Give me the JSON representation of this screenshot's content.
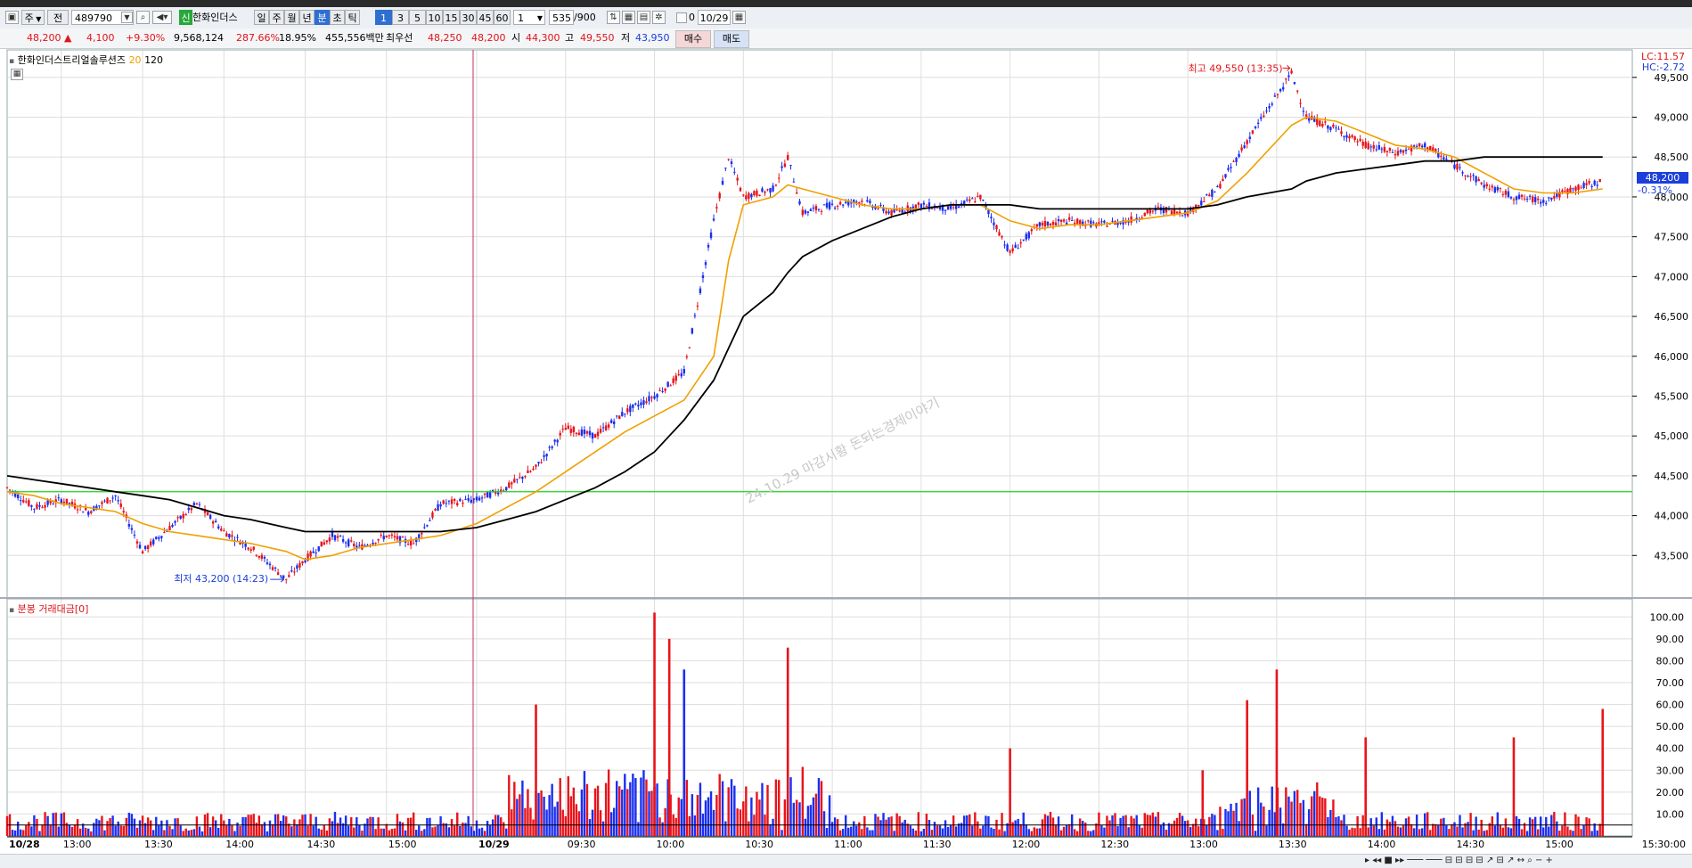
{
  "toolbar": {
    "type_label": "주",
    "prev_label": "전",
    "code": "489790",
    "badge": "신",
    "name": "한화인더스",
    "periods": [
      "일",
      "주",
      "월",
      "년",
      "분",
      "초",
      "틱"
    ],
    "active_period": "분",
    "intervals": [
      "1",
      "3",
      "5",
      "10",
      "15",
      "30",
      "45",
      "60"
    ],
    "active_interval": "1",
    "custom_interval": "1",
    "count": "535",
    "count_total": "/900",
    "date_checkbox_label": "0",
    "date": "10/29"
  },
  "quote": {
    "price": "48,200",
    "change_arrow": "▲",
    "change": "4,100",
    "change_pct": "+9.30%",
    "volume": "9,568,124",
    "vol_ratio": "287.66%",
    "turnover": "18.95%",
    "amount": "455,556백만",
    "bid_label": "최우선",
    "bid": "48,250",
    "ask": "48,200",
    "open_label": "시",
    "open": "44,300",
    "high_label": "고",
    "high": "49,550",
    "low_label": "저",
    "low": "43,950",
    "buy_label": "매수",
    "sell_label": "매도"
  },
  "price_panel": {
    "legend_name": "한화인더스트리얼솔루션즈",
    "ma1_label": "20",
    "ma2_label": "120",
    "max_annotation": "최고 49,550 (13:35)",
    "min_annotation": "최저 43,200 (14:23)",
    "watermark": "24.10.29 마감시황 돈되는경제이야기",
    "lc": "LC:11.57",
    "hc": "HC:-2.72",
    "price_tag": "48,200",
    "price_tag_pct": "-0.31%"
  },
  "volume_panel": {
    "legend": "분봉 거래대금[0]"
  },
  "x_labels": [
    "10/28",
    "13:00",
    "13:30",
    "14:00",
    "14:30",
    "15:00",
    "10/29",
    "09:30",
    "10:00",
    "10:30",
    "11:00",
    "11:30",
    "12:00",
    "12:30",
    "13:00",
    "13:30",
    "14:00",
    "14:30",
    "15:00"
  ],
  "x_right_label": "15:30:00",
  "colors": {
    "up": "#e8141a",
    "down": "#1b2ff0",
    "ma20": "#f0a000",
    "ma120": "#000000",
    "hline": "#19d419",
    "grid": "#dedede"
  },
  "chart_data": [
    {
      "type": "candlestick",
      "title": "",
      "y_ticks": [
        "49,500",
        "49,000",
        "48,500",
        "48,000",
        "47,500",
        "47,000",
        "46,500",
        "46,000",
        "45,500",
        "45,000",
        "44,500",
        "44,000",
        "43,500"
      ],
      "ylim": [
        43000,
        49800
      ],
      "horizontal_line": 44300,
      "close_series": [
        {
          "t": "10/28 12:40",
          "v": 44350
        },
        {
          "t": "12:50",
          "v": 44100
        },
        {
          "t": "13:00",
          "v": 44200
        },
        {
          "t": "13:10",
          "v": 44050
        },
        {
          "t": "13:20",
          "v": 44250
        },
        {
          "t": "13:30",
          "v": 43550
        },
        {
          "t": "13:40",
          "v": 43850
        },
        {
          "t": "13:50",
          "v": 44150
        },
        {
          "t": "14:00",
          "v": 43800
        },
        {
          "t": "14:10",
          "v": 43600
        },
        {
          "t": "14:23",
          "v": 43200
        },
        {
          "t": "14:30",
          "v": 43450
        },
        {
          "t": "14:40",
          "v": 43750
        },
        {
          "t": "14:50",
          "v": 43600
        },
        {
          "t": "15:00",
          "v": 43750
        },
        {
          "t": "15:10",
          "v": 43650
        },
        {
          "t": "15:20",
          "v": 44150
        },
        {
          "t": "10/29 09:00",
          "v": 44200
        },
        {
          "t": "09:10",
          "v": 44350
        },
        {
          "t": "09:20",
          "v": 44600
        },
        {
          "t": "09:30",
          "v": 45100
        },
        {
          "t": "09:40",
          "v": 45000
        },
        {
          "t": "09:50",
          "v": 45300
        },
        {
          "t": "10:00",
          "v": 45500
        },
        {
          "t": "10:10",
          "v": 45800
        },
        {
          "t": "10:20",
          "v": 47700
        },
        {
          "t": "10:25",
          "v": 48500
        },
        {
          "t": "10:30",
          "v": 48000
        },
        {
          "t": "10:40",
          "v": 48100
        },
        {
          "t": "10:45",
          "v": 48500
        },
        {
          "t": "10:50",
          "v": 47800
        },
        {
          "t": "11:00",
          "v": 47900
        },
        {
          "t": "11:10",
          "v": 47950
        },
        {
          "t": "11:20",
          "v": 47800
        },
        {
          "t": "11:30",
          "v": 47900
        },
        {
          "t": "11:40",
          "v": 47850
        },
        {
          "t": "11:50",
          "v": 48000
        },
        {
          "t": "12:00",
          "v": 47300
        },
        {
          "t": "12:10",
          "v": 47650
        },
        {
          "t": "12:20",
          "v": 47700
        },
        {
          "t": "12:30",
          "v": 47650
        },
        {
          "t": "12:40",
          "v": 47700
        },
        {
          "t": "12:50",
          "v": 47850
        },
        {
          "t": "13:00",
          "v": 47800
        },
        {
          "t": "13:10",
          "v": 48100
        },
        {
          "t": "13:20",
          "v": 48700
        },
        {
          "t": "13:35",
          "v": 49550
        },
        {
          "t": "13:40",
          "v": 49000
        },
        {
          "t": "13:50",
          "v": 48850
        },
        {
          "t": "14:00",
          "v": 48650
        },
        {
          "t": "14:10",
          "v": 48550
        },
        {
          "t": "14:20",
          "v": 48650
        },
        {
          "t": "14:30",
          "v": 48400
        },
        {
          "t": "14:40",
          "v": 48150
        },
        {
          "t": "14:50",
          "v": 48000
        },
        {
          "t": "15:00",
          "v": 47950
        },
        {
          "t": "15:10",
          "v": 48100
        },
        {
          "t": "15:20",
          "v": 48200
        }
      ],
      "series": [
        {
          "name": "20",
          "values": [
            44300,
            44250,
            44150,
            44100,
            44050,
            43900,
            43800,
            43750,
            43700,
            43650,
            43550,
            43450,
            43500,
            43600,
            43650,
            43700,
            43750,
            43900,
            44100,
            44300,
            44550,
            44800,
            45050,
            45250,
            45450,
            46000,
            47200,
            47900,
            48000,
            48150,
            48100,
            48000,
            47900,
            47850,
            47850,
            47900,
            47900,
            47700,
            47600,
            47650,
            47650,
            47700,
            47750,
            47800,
            47950,
            48300,
            48900,
            49000,
            48950,
            48800,
            48650,
            48600,
            48500,
            48300,
            48100,
            48050,
            48050,
            48100
          ]
        },
        {
          "name": "120",
          "values": [
            44500,
            44450,
            44400,
            44350,
            44300,
            44250,
            44200,
            44100,
            44000,
            43950,
            43850,
            43800,
            43800,
            43800,
            43800,
            43800,
            43800,
            43850,
            43950,
            44050,
            44200,
            44350,
            44550,
            44800,
            45200,
            45700,
            46100,
            46500,
            46800,
            47050,
            47250,
            47450,
            47600,
            47750,
            47850,
            47900,
            47900,
            47900,
            47850,
            47850,
            47850,
            47850,
            47850,
            47850,
            47900,
            48000,
            48100,
            48200,
            48300,
            48350,
            48400,
            48450,
            48450,
            48500,
            48500,
            48500,
            48500,
            48500
          ]
        }
      ]
    },
    {
      "type": "bar",
      "title": "",
      "y_ticks": [
        "100.00",
        "90.00",
        "80.00",
        "70.00",
        "60.00",
        "50.00",
        "40.00",
        "30.00",
        "20.00",
        "10.00"
      ],
      "ylim": [
        0,
        105
      ],
      "reference_line": 5,
      "notable_bars": [
        {
          "t": "10:00",
          "v": 102,
          "dir": "up"
        },
        {
          "t": "10:05",
          "v": 90,
          "dir": "up"
        },
        {
          "t": "10:10",
          "v": 76,
          "dir": "down"
        },
        {
          "t": "10:45",
          "v": 86,
          "dir": "up"
        },
        {
          "t": "09:20",
          "v": 60,
          "dir": "up"
        },
        {
          "t": "13:30",
          "v": 76,
          "dir": "up"
        },
        {
          "t": "13:20",
          "v": 62,
          "dir": "up"
        },
        {
          "t": "15:20",
          "v": 58,
          "dir": "up"
        },
        {
          "t": "14:00",
          "v": 45,
          "dir": "up"
        },
        {
          "t": "14:50",
          "v": 45,
          "dir": "up"
        },
        {
          "t": "12:00",
          "v": 40,
          "dir": "up"
        },
        {
          "t": "13:05",
          "v": 30,
          "dir": "up"
        }
      ]
    }
  ]
}
